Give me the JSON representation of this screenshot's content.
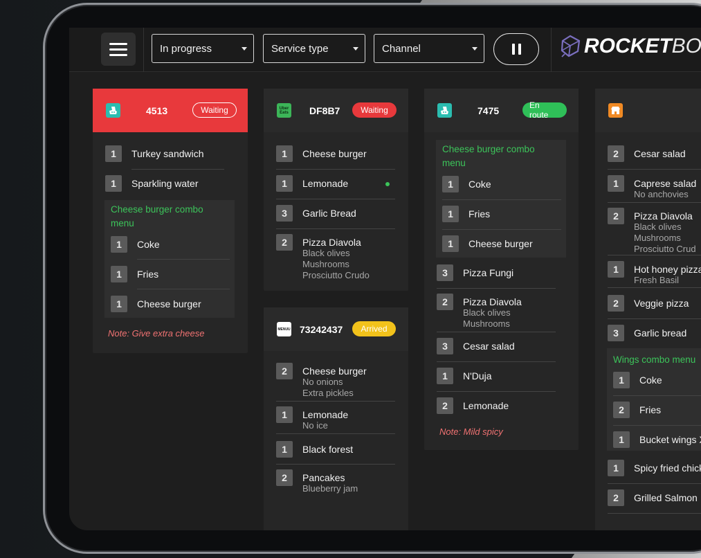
{
  "toolbar": {
    "status_filter": "In progress",
    "service_filter": "Service type",
    "channel_filter": "Channel"
  },
  "logo": {
    "rocket": "ROCKET",
    "box": "BOX"
  },
  "orders": [
    {
      "brand": "deliveroo",
      "number": "4513",
      "status": "Waiting",
      "items": [
        {
          "qty": "1",
          "name": "Turkey sandwich"
        },
        {
          "qty": "1",
          "name": "Sparkling water"
        }
      ],
      "combo": {
        "title": "Cheese burger combo menu",
        "items": [
          {
            "qty": "1",
            "name": "Coke"
          },
          {
            "qty": "1",
            "name": "Fries"
          },
          {
            "qty": "1",
            "name": "Cheese burger"
          }
        ]
      },
      "note": "Note: Give extra cheese"
    },
    {
      "brand": "uber-eats",
      "brand_label": "Uber Eats",
      "number": "DF8B7",
      "status": "Waiting",
      "items": [
        {
          "qty": "1",
          "name": "Cheese burger"
        },
        {
          "qty": "1",
          "name": "Lemonade"
        },
        {
          "qty": "3",
          "name": "Garlic Bread"
        },
        {
          "qty": "2",
          "name": "Pizza Diavola",
          "mods": [
            "Black olives",
            "Mushrooms",
            "Prosciutto Crudo"
          ]
        }
      ]
    },
    {
      "brand": "menu",
      "brand_label": "MENUU",
      "number": "73242437",
      "status": "Arrived",
      "items": [
        {
          "qty": "2",
          "name": "Cheese burger",
          "mods": [
            "No onions",
            "Extra pickles"
          ]
        },
        {
          "qty": "1",
          "name": "Lemonade",
          "mods": [
            "No ice"
          ]
        },
        {
          "qty": "1",
          "name": "Black forest"
        },
        {
          "qty": "2",
          "name": "Pancakes",
          "mods": [
            "Blueberry jam"
          ]
        }
      ]
    },
    {
      "brand": "deliveroo",
      "number": "7475",
      "status": "En route",
      "combo": {
        "title": "Cheese burger combo menu",
        "items": [
          {
            "qty": "1",
            "name": "Coke"
          },
          {
            "qty": "1",
            "name": "Fries"
          },
          {
            "qty": "1",
            "name": "Cheese burger"
          }
        ]
      },
      "items": [
        {
          "qty": "3",
          "name": "Pizza Fungi"
        },
        {
          "qty": "2",
          "name": "Pizza Diavola",
          "mods": [
            "Black olives",
            "Mushrooms"
          ]
        },
        {
          "qty": "3",
          "name": "Cesar salad"
        },
        {
          "qty": "1",
          "name": "N'Duja"
        },
        {
          "qty": "2",
          "name": "Lemonade"
        }
      ],
      "note": "Note: Mild spicy"
    },
    {
      "brand": "web-shop",
      "items": [
        {
          "qty": "2",
          "name": "Cesar salad"
        },
        {
          "qty": "1",
          "name": "Caprese salad",
          "mods": [
            "No anchovies"
          ]
        },
        {
          "qty": "2",
          "name": "Pizza Diavola",
          "mods": [
            "Black olives",
            "Mushrooms",
            "Prosciutto Crud"
          ]
        },
        {
          "qty": "1",
          "name": "Hot honey pizza",
          "mods": [
            "Fresh Basil"
          ]
        },
        {
          "qty": "2",
          "name": "Veggie pizza"
        },
        {
          "qty": "3",
          "name": "Garlic bread"
        }
      ],
      "combo": {
        "title": "Wings combo menu",
        "items": [
          {
            "qty": "1",
            "name": "Coke"
          },
          {
            "qty": "2",
            "name": "Fries"
          },
          {
            "qty": "1",
            "name": "Bucket wings X"
          }
        ]
      },
      "items_after": [
        {
          "qty": "1",
          "name": "Spicy fried chick"
        },
        {
          "qty": "2",
          "name": "Grilled Salmon"
        }
      ]
    }
  ],
  "colors": {
    "waiting": "#e8393c",
    "en_route": "#2fbf58",
    "arrived": "#f2c21b",
    "combo_title": "#3cc45a",
    "note": "#f07272",
    "deliveroo": "#2bbdb0",
    "uber_eats": "#3cb558",
    "web_shop": "#f08a24"
  }
}
